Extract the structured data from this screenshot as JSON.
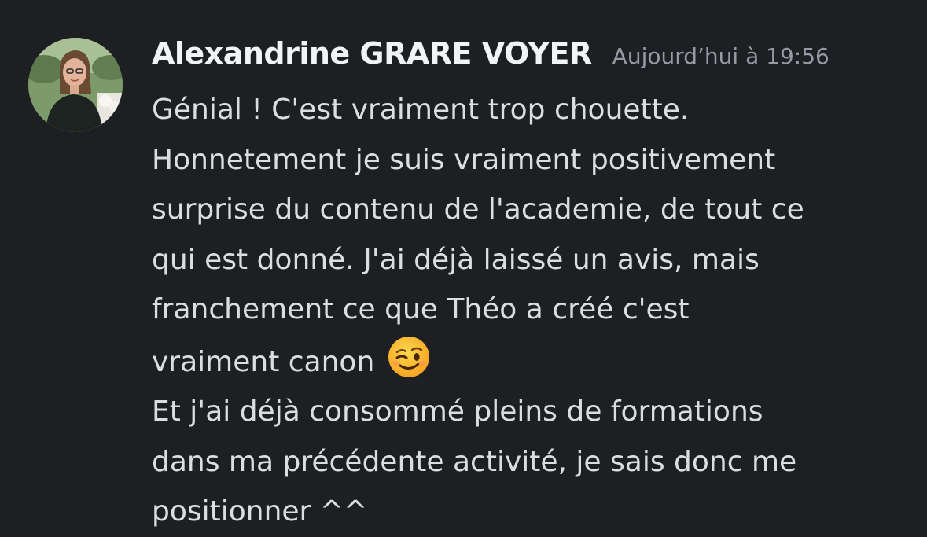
{
  "message": {
    "author": "Alexandrine GRARE VOYER",
    "timestamp": "Aujourd’hui à 19:56",
    "lines": [
      "Génial ! C'est vraiment trop chouette.",
      "Honnetement je suis vraiment positivement",
      "surprise du contenu de l'academie, de tout ce",
      "qui est donné. J'ai déjà laissé un avis, mais",
      "franchement ce que Théo a créé c'est",
      "vraiment canon",
      "Et j'ai déjà consommé pleins de formations",
      "dans ma précédente activité, je sais donc me",
      "positionner ^^"
    ],
    "emoji": "winking-face-icon"
  },
  "colors": {
    "background": "#1e1f22",
    "username": "#f2f3f5",
    "timestamp": "#949ba4",
    "text": "#dbdee1"
  }
}
